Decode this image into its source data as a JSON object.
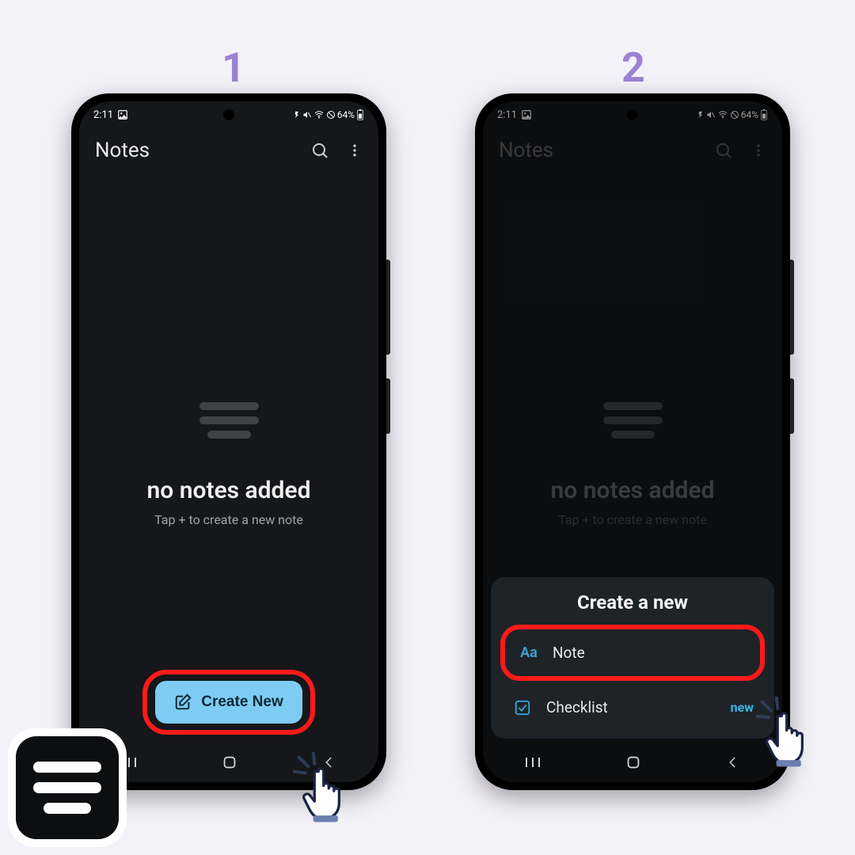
{
  "steps": {
    "one": "1",
    "two": "2"
  },
  "status": {
    "time": "2:11",
    "battery": "64%"
  },
  "appbar": {
    "title": "Notes"
  },
  "empty": {
    "headline": "no notes added",
    "sub": "Tap + to create a new note"
  },
  "fab": {
    "label": "Create New"
  },
  "sheet": {
    "title": "Create a new",
    "note": "Note",
    "note_icon": "Aa",
    "checklist": "Checklist",
    "checklist_badge": "new"
  }
}
